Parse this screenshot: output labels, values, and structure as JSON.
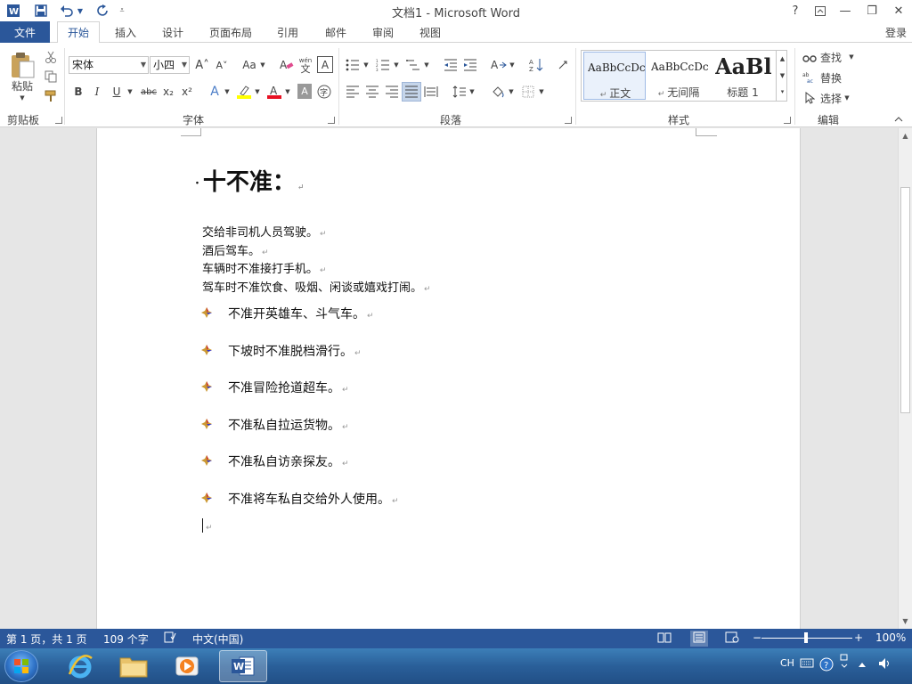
{
  "titlebar": {
    "title": "文档1 - Microsoft Word",
    "help": "?",
    "ribbon_display": "↥",
    "minimize": "—",
    "restore": "❐",
    "close": "✕",
    "quick_access": [
      "word-icon",
      "save-icon",
      "undo-icon",
      "redo-icon",
      "customize-icon"
    ]
  },
  "tabs": {
    "file": "文件",
    "items": [
      "开始",
      "插入",
      "设计",
      "页面布局",
      "引用",
      "邮件",
      "审阅",
      "视图"
    ],
    "active": "开始",
    "login": "登录"
  },
  "ribbon": {
    "clipboard": {
      "label": "剪贴板",
      "paste": "粘贴"
    },
    "font": {
      "label": "字体",
      "font_name": "宋体",
      "font_size": "小四",
      "grow": "A˄",
      "shrink": "A˅",
      "change_case": "Aa",
      "phonetic": "wén",
      "bold": "B",
      "italic": "I",
      "underline": "U",
      "strike": "abc",
      "subscript": "x₂",
      "superscript": "x²"
    },
    "paragraph": {
      "label": "段落"
    },
    "styles": {
      "label": "样式",
      "items": [
        {
          "preview": "AaBbCcDc",
          "name": "正文"
        },
        {
          "preview": "AaBbCcDc",
          "name": "无间隔"
        },
        {
          "preview": "AaBl",
          "name": "标题 1"
        }
      ]
    },
    "editing": {
      "label": "编辑",
      "find": "查找",
      "replace": "替换",
      "select": "选择"
    }
  },
  "document": {
    "heading": "十不准：",
    "plain_lines": [
      "交给非司机人员驾驶。",
      "酒后驾车。",
      "车辆时不准接打手机。",
      "驾车时不准饮食、吸烟、闲谈或嬉戏打闹。"
    ],
    "bullet_items": [
      "不准开英雄车、斗气车。",
      "下坡时不准脱档滑行。",
      "不准冒险抢道超车。",
      "不准私自拉运货物。",
      "不准私自访亲探友。",
      "不准将车私自交给外人使用。"
    ],
    "paragraph_mark": "↵"
  },
  "statusbar": {
    "page": "第 1 页，共 1 页",
    "word_count": "109 个字",
    "language": "中文(中国)",
    "zoom": "100%"
  },
  "taskbar": {
    "apps": [
      "start-orb",
      "ie-icon",
      "explorer-icon",
      "media-player-icon",
      "word-icon"
    ],
    "active": "word-icon",
    "ime": "CH"
  }
}
